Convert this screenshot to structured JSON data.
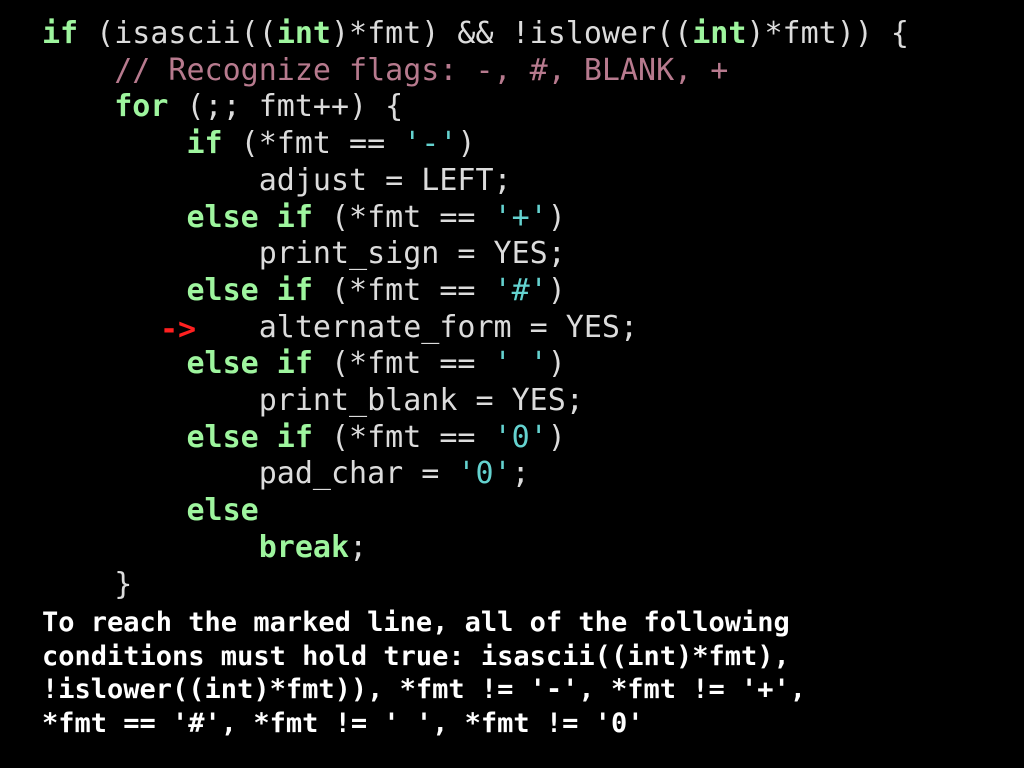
{
  "code": {
    "lines": [
      [
        {
          "t": "if",
          "c": "kw"
        },
        {
          "t": " (isascii((",
          "c": "tx"
        },
        {
          "t": "int",
          "c": "kw"
        },
        {
          "t": ")*fmt) && !islower((",
          "c": "tx"
        },
        {
          "t": "int",
          "c": "kw"
        },
        {
          "t": ")*fmt)) {",
          "c": "tx"
        }
      ],
      [
        {
          "t": "    ",
          "c": "tx"
        },
        {
          "t": "// Recognize flags: -, #, BLANK, +",
          "c": "cm"
        }
      ],
      [
        {
          "t": "    ",
          "c": "tx"
        },
        {
          "t": "for",
          "c": "kw"
        },
        {
          "t": " (;; fmt++) {",
          "c": "tx"
        }
      ],
      [
        {
          "t": "        ",
          "c": "tx"
        },
        {
          "t": "if",
          "c": "kw"
        },
        {
          "t": " (*fmt == ",
          "c": "tx"
        },
        {
          "t": "'-'",
          "c": "ch"
        },
        {
          "t": ")",
          "c": "tx"
        }
      ],
      [
        {
          "t": "            adjust = LEFT;",
          "c": "tx"
        }
      ],
      [
        {
          "t": "        ",
          "c": "tx"
        },
        {
          "t": "else if",
          "c": "kw"
        },
        {
          "t": " (*fmt == ",
          "c": "tx"
        },
        {
          "t": "'+'",
          "c": "ch"
        },
        {
          "t": ")",
          "c": "tx"
        }
      ],
      [
        {
          "t": "            print_sign = YES;",
          "c": "tx"
        }
      ],
      [
        {
          "t": "        ",
          "c": "tx"
        },
        {
          "t": "else if",
          "c": "kw"
        },
        {
          "t": " (*fmt == ",
          "c": "tx"
        },
        {
          "t": "'#'",
          "c": "ch"
        },
        {
          "t": ")",
          "c": "tx"
        }
      ],
      [
        {
          "t": "            alternate_form = YES;",
          "c": "tx"
        }
      ],
      [
        {
          "t": "        ",
          "c": "tx"
        },
        {
          "t": "else if",
          "c": "kw"
        },
        {
          "t": " (*fmt == ",
          "c": "tx"
        },
        {
          "t": "' '",
          "c": "ch"
        },
        {
          "t": ")",
          "c": "tx"
        }
      ],
      [
        {
          "t": "            print_blank = YES;",
          "c": "tx"
        }
      ],
      [
        {
          "t": "        ",
          "c": "tx"
        },
        {
          "t": "else if",
          "c": "kw"
        },
        {
          "t": " (*fmt == ",
          "c": "tx"
        },
        {
          "t": "'0'",
          "c": "ch"
        },
        {
          "t": ")",
          "c": "tx"
        }
      ],
      [
        {
          "t": "            pad_char = ",
          "c": "tx"
        },
        {
          "t": "'0'",
          "c": "ch"
        },
        {
          "t": ";",
          "c": "tx"
        }
      ],
      [
        {
          "t": "        ",
          "c": "tx"
        },
        {
          "t": "else",
          "c": "kw"
        }
      ],
      [
        {
          "t": "            ",
          "c": "tx"
        },
        {
          "t": "break",
          "c": "kw"
        },
        {
          "t": ";",
          "c": "tx"
        }
      ],
      [
        {
          "t": "    }",
          "c": "tx"
        }
      ]
    ],
    "marked_line_index": 8,
    "marker": "->"
  },
  "explanation": {
    "lines": [
      "To reach the marked line, all of the following",
      "conditions must hold true: isascii((int)*fmt),",
      "!islower((int)*fmt)), *fmt != '-', *fmt != '+',",
      "*fmt == '#', *fmt != ' ', *fmt != '0'"
    ]
  },
  "colors": {
    "background": "#000000",
    "keyword": "#9ef59e",
    "comment": "#b77a8e",
    "char_literal": "#64d2cf",
    "text": "#dcdcdc",
    "marker": "#ff2020",
    "explanation": "#ffffff"
  }
}
